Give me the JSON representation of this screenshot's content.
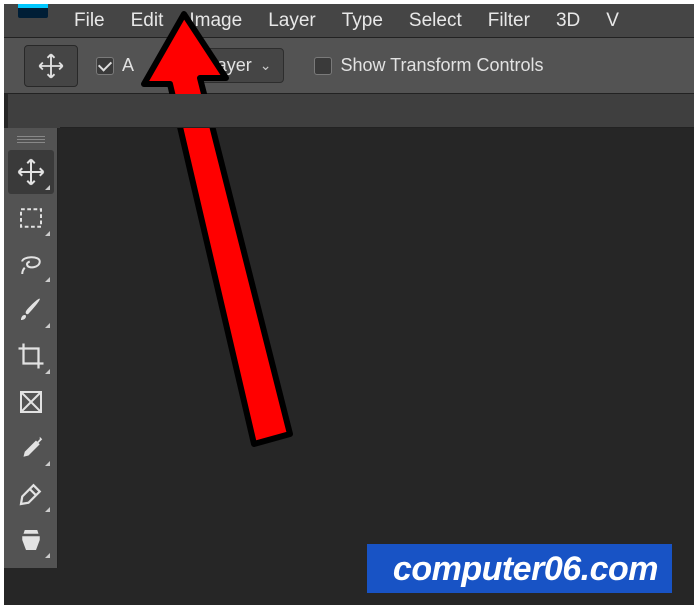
{
  "menu": {
    "items": [
      "File",
      "Edit",
      "Image",
      "Layer",
      "Type",
      "Select",
      "Filter",
      "3D",
      "V"
    ]
  },
  "options": {
    "auto_select_label": "A",
    "target_select": "Layer",
    "show_transform_label": "Show Transform Controls"
  },
  "tools_left": [
    {
      "name": "move-tool",
      "active": true,
      "tri": true
    },
    {
      "name": "marquee-tool",
      "tri": true
    },
    {
      "name": "lasso-tool",
      "tri": true
    },
    {
      "name": "brush-tool",
      "tri": true
    },
    {
      "name": "crop-tool",
      "tri": true
    },
    {
      "name": "frame-tool",
      "tri": false
    },
    {
      "name": "eyedropper-tool",
      "tri": true
    },
    {
      "name": "healing-brush-tool",
      "tri": true
    },
    {
      "name": "clone-stamp-tool",
      "tri": true
    }
  ],
  "watermark_text": "computer06.com"
}
